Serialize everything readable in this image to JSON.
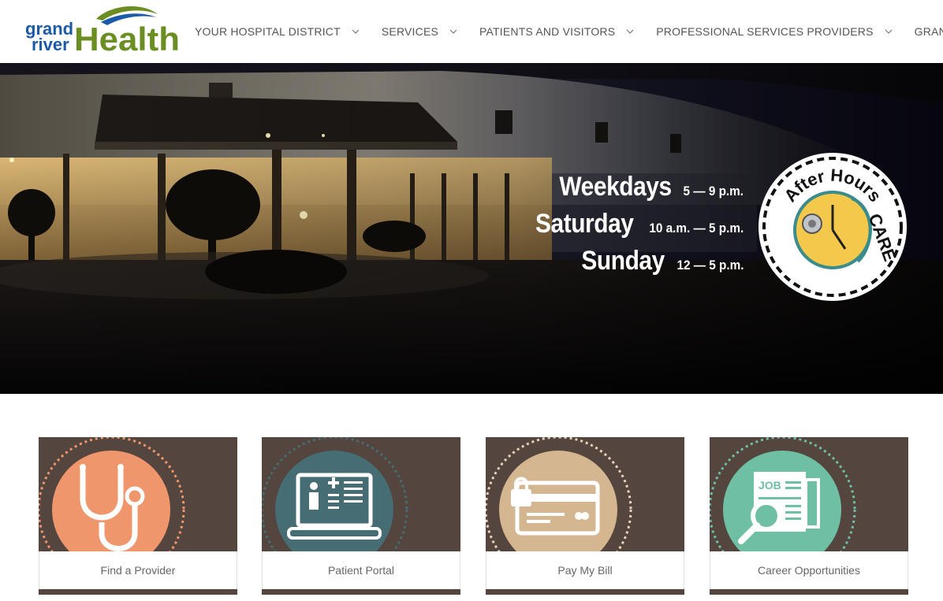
{
  "header": {
    "logo": {
      "line1": "grand",
      "line2": "river",
      "word": "Health"
    },
    "nav": [
      {
        "label": "YOUR HOSPITAL DISTRICT"
      },
      {
        "label": "SERVICES"
      },
      {
        "label": "PATIENTS AND VISITORS"
      },
      {
        "label": "PROFESSIONAL SERVICES PROVIDERS"
      },
      {
        "label": "GRAND RIVE"
      }
    ]
  },
  "hero": {
    "hours": [
      {
        "day": "Weekdays",
        "time": "5 — 9 p.m."
      },
      {
        "day": "Saturday",
        "time": "10 a.m. — 5 p.m."
      },
      {
        "day": "Sunday",
        "time": "12 — 5 p.m."
      }
    ],
    "badge": {
      "text_top": "After Hours",
      "text_side": "CARE"
    }
  },
  "cards": [
    {
      "label": "Find a Provider",
      "icon": "stethoscope-icon",
      "color": "#f0966c",
      "ring": "#f0966c"
    },
    {
      "label": "Patient Portal",
      "icon": "laptop-chart-icon",
      "color": "#466c74",
      "ring": "#466c74"
    },
    {
      "label": "Pay My Bill",
      "icon": "credit-card-lock-icon",
      "color": "#d4b690",
      "ring": "#e8d4b6"
    },
    {
      "label": "Career Opportunities",
      "icon": "job-search-icon",
      "color": "#6fbfa4",
      "ring": "#6fbfa4"
    }
  ],
  "colors": {
    "brand_blue": "#1b5aa6",
    "brand_green": "#6b8e23",
    "card_brown": "#54453e"
  }
}
